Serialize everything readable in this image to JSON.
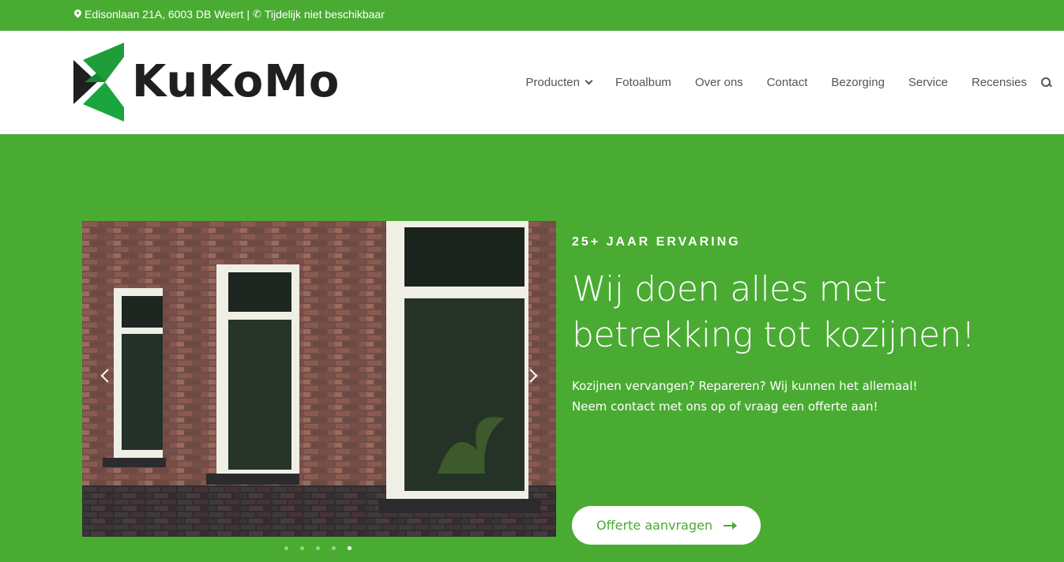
{
  "topbar": {
    "address": "Edisonlaan 21A, 6003 DB Weert",
    "separator": "|",
    "phone": "Tijdelijk niet beschikbaar",
    "address_icon": "map-marker-icon",
    "phone_icon": "phone-icon"
  },
  "logo": {
    "text": "KuKoMo"
  },
  "nav": {
    "items": [
      {
        "label": "Producten",
        "has_dropdown": true
      },
      {
        "label": "Fotoalbum"
      },
      {
        "label": "Over ons"
      },
      {
        "label": "Contact"
      },
      {
        "label": "Bezorging"
      },
      {
        "label": "Service"
      },
      {
        "label": "Recensies"
      }
    ],
    "search_icon": "search-icon"
  },
  "hero": {
    "eyebrow": "25+ JAAR ERVARING",
    "headline": "Wij doen alles met betrekking tot kozijnen!",
    "sub_line1": "Kozijnen vervangen? Repareren? Wij kunnen het allemaal!",
    "sub_line2": "Neem contact met ons op of vraag een offerte aan!",
    "cta_label": "Offerte aanvragen",
    "slider": {
      "total_slides": 5,
      "active_slide": 5
    }
  },
  "colors": {
    "brand_green": "#4aab33",
    "logo_dark": "#1f1f1f",
    "logo_green": "#1f9d3a",
    "nav_text": "#555555"
  }
}
